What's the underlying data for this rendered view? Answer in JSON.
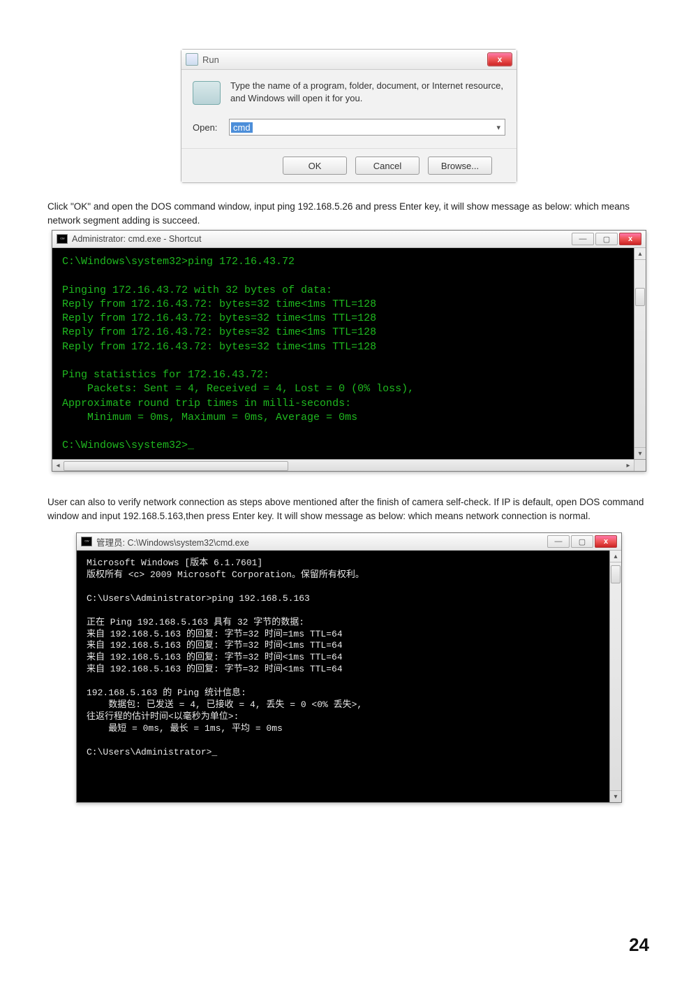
{
  "run_dialog": {
    "title": "Run",
    "close_glyph": "x",
    "description": "Type the name of a program, folder, document, or Internet resource, and Windows will open it for you.",
    "open_label": "Open:",
    "input_value": "cmd",
    "dropdown_glyph": "▾",
    "ok_label": "OK",
    "cancel_label": "Cancel",
    "browse_label": "Browse..."
  },
  "para1": "Click \"OK\" and open the DOS command window, input ping 192.168.5.26 and press Enter key, it will show message as below: which means network segment adding is succeed.",
  "cmd1": {
    "title": "Administrator: cmd.exe - Shortcut",
    "min_glyph": "—",
    "max_glyph": "▢",
    "close_glyph": "x",
    "text": "C:\\Windows\\system32>ping 172.16.43.72\n\nPinging 172.16.43.72 with 32 bytes of data:\nReply from 172.16.43.72: bytes=32 time<1ms TTL=128\nReply from 172.16.43.72: bytes=32 time<1ms TTL=128\nReply from 172.16.43.72: bytes=32 time<1ms TTL=128\nReply from 172.16.43.72: bytes=32 time<1ms TTL=128\n\nPing statistics for 172.16.43.72:\n    Packets: Sent = 4, Received = 4, Lost = 0 (0% loss),\nApproximate round trip times in milli-seconds:\n    Minimum = 0ms, Maximum = 0ms, Average = 0ms\n\nC:\\Windows\\system32>_"
  },
  "para2": "User can also to verify network connection as steps above mentioned after the finish of camera self-check. If IP is default, open DOS command window and input 192.168.5.163,then press Enter key. It will show message as below: which means network connection is normal.",
  "cmd2": {
    "title": "管理员: C:\\Windows\\system32\\cmd.exe",
    "min_glyph": "—",
    "max_glyph": "▢",
    "close_glyph": "x",
    "text": "Microsoft Windows [版本 6.1.7601]\n版权所有 <c> 2009 Microsoft Corporation。保留所有权利。\n\nC:\\Users\\Administrator>ping 192.168.5.163\n\n正在 Ping 192.168.5.163 具有 32 字节的数据:\n来自 192.168.5.163 的回复: 字节=32 时间=1ms TTL=64\n来自 192.168.5.163 的回复: 字节=32 时间<1ms TTL=64\n来自 192.168.5.163 的回复: 字节=32 时间<1ms TTL=64\n来自 192.168.5.163 的回复: 字节=32 时间<1ms TTL=64\n\n192.168.5.163 的 Ping 统计信息:\n    数据包: 已发送 = 4, 已接收 = 4, 丢失 = 0 <0% 丢失>,\n往返行程的估计时间<以毫秒为单位>:\n    最短 = 0ms, 最长 = 1ms, 平均 = 0ms\n\nC:\\Users\\Administrator>_\n\n\n\n\n\n"
  },
  "page_number": "24"
}
